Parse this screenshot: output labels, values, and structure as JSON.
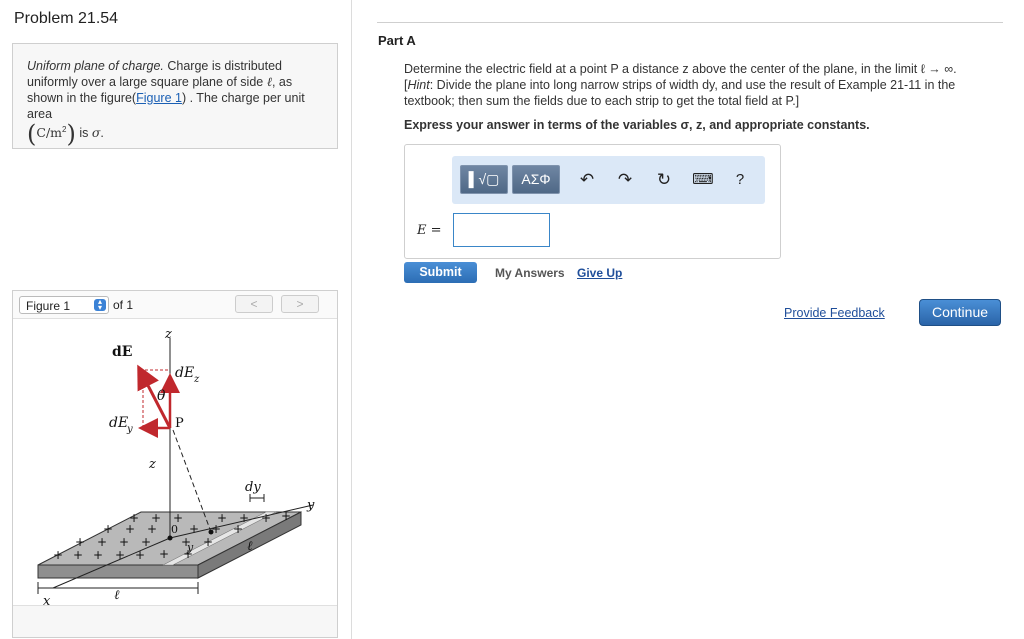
{
  "problem": {
    "title": "Problem 21.54"
  },
  "intro": {
    "italic_lead": "Uniform plane of charge.",
    "text1": " Charge is distributed uniformly over a large square plane of side ",
    "ell": "ℓ",
    "text2": ", as shown in the figure(",
    "figure_link": "Figure 1",
    "text3": ") . The charge per unit area ",
    "unit": "C/m",
    "unit_exp": "2",
    "text4": " is ",
    "sigma": "σ",
    "end": "."
  },
  "figure": {
    "select_value": "Figure 1",
    "of_text": "of 1",
    "prev": "<",
    "next": ">",
    "labels": {
      "dE": "dE",
      "dEz": "dE",
      "dEz_sub": "z",
      "dEy": "dE",
      "dEy_sub": "y",
      "theta": "θ",
      "P": "P",
      "z_top": "z",
      "z_mid": "z",
      "dy": "dy",
      "y": "y",
      "x": "x",
      "y_small": "y",
      "ell1": "ℓ",
      "ell2": "ℓ",
      "zero": "0"
    }
  },
  "part": {
    "title": "Part A"
  },
  "question": {
    "line": "Determine the electric field at a point P a distance z above the center of the plane, in the limit ℓ → ∞.",
    "hint_label": "Hint",
    "hint": ": Divide the plane into long narrow strips of width dy, and use the result of Example 21-11 in the textbook; then sum the fields due to each strip to get the total field at P.]",
    "hint_open": "["
  },
  "express": "Express your answer in terms of the variables σ, z, and appropriate constants.",
  "toolbar": {
    "template_label": "▌√▢",
    "greek_label": "ΑΣΦ",
    "undo": "↶",
    "redo": "↷",
    "reset": "↻",
    "keyboard": "⌨",
    "help": "?"
  },
  "answer": {
    "label": "E =",
    "value": ""
  },
  "actions": {
    "submit": "Submit",
    "my_answers": "My Answers",
    "give_up": "Give Up",
    "feedback": "Provide Feedback",
    "continue": "Continue"
  },
  "colors": {
    "accent": "#2c6db4",
    "link": "#1f4e9a",
    "arrow": "#c0282d"
  }
}
